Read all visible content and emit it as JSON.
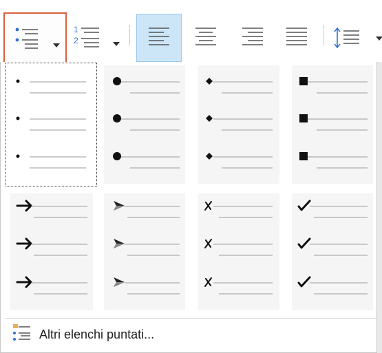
{
  "toolbar": {
    "buttons": [
      {
        "name": "bullets-button",
        "icon": "bullet-list-icon",
        "has_dropdown": true,
        "selected": true
      },
      {
        "name": "numbering-button",
        "icon": "numbered-list-icon",
        "has_dropdown": true,
        "selected": false
      },
      {
        "name": "align-left-button",
        "icon": "align-left-icon",
        "active": true
      },
      {
        "name": "align-center-button",
        "icon": "align-center-icon",
        "active": false
      },
      {
        "name": "align-right-button",
        "icon": "align-right-icon",
        "active": false
      },
      {
        "name": "justify-button",
        "icon": "justify-icon",
        "active": false
      },
      {
        "name": "line-spacing-button",
        "icon": "line-spacing-icon",
        "has_dropdown": true
      }
    ]
  },
  "bullet_library": {
    "styles": [
      {
        "name": "bullet-style-small-dot",
        "symbol": "dot",
        "selected": true
      },
      {
        "name": "bullet-style-filled-circle",
        "symbol": "circle",
        "selected": false
      },
      {
        "name": "bullet-style-diamond",
        "symbol": "diamond",
        "selected": false
      },
      {
        "name": "bullet-style-square",
        "symbol": "square",
        "selected": false
      },
      {
        "name": "bullet-style-arrow",
        "symbol": "arrow",
        "selected": false
      },
      {
        "name": "bullet-style-arrowhead",
        "symbol": "arrowhead",
        "selected": false
      },
      {
        "name": "bullet-style-cross",
        "symbol": "cross",
        "selected": false
      },
      {
        "name": "bullet-style-checkmark",
        "symbol": "check",
        "selected": false
      }
    ]
  },
  "footer": {
    "label": "Altri elenchi puntati...",
    "icon": "bullets-settings-icon"
  },
  "colors": {
    "selection_border": "#d9603b",
    "active_fill": "#cde6f7",
    "number_blue": "#2e6fd1"
  }
}
